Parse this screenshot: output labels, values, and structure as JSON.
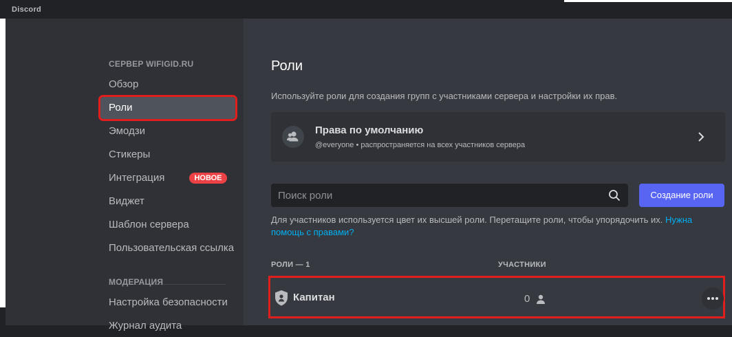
{
  "window": {
    "title": "Discord"
  },
  "sidebar": {
    "server_header": "СЕРВЕР WIFIGID.RU",
    "items": [
      {
        "label": "Обзор"
      },
      {
        "label": "Роли"
      },
      {
        "label": "Эмодзи"
      },
      {
        "label": "Стикеры"
      },
      {
        "label": "Интеграция",
        "badge": "НОВОЕ"
      },
      {
        "label": "Виджет"
      },
      {
        "label": "Шаблон сервера"
      },
      {
        "label": "Пользовательская ссылка"
      }
    ],
    "moderation_header": "МОДЕРАЦИЯ",
    "moderation_items": [
      {
        "label": "Настройка безопасности"
      },
      {
        "label": "Журнал аудита"
      }
    ]
  },
  "main": {
    "title": "Роли",
    "description": "Используйте роли для создания групп с участниками сервера и настройки их прав.",
    "default_permissions": {
      "title": "Права по умолчанию",
      "subtitle": "@everyone • распространяется на всех участников сервера"
    },
    "search": {
      "placeholder": "Поиск роли"
    },
    "create_button": "Создание роли",
    "hint": {
      "text": "Для участников используется цвет их высшей роли. Перетащите роли, чтобы упорядочить их. ",
      "link": "Нужна помощь с правами?"
    },
    "table": {
      "roles_header": "РОЛИ — 1",
      "members_header": "УЧАСТНИКИ",
      "rows": [
        {
          "name": "Капитан",
          "members": "0"
        }
      ]
    }
  },
  "colors": {
    "accent": "#5865f2",
    "badge": "#ed4245",
    "highlight": "#e01e1e",
    "link": "#00aff4"
  },
  "icons": [
    "users-icon",
    "chevron-right-icon",
    "search-icon",
    "shield-icon",
    "person-icon",
    "more-icon"
  ]
}
